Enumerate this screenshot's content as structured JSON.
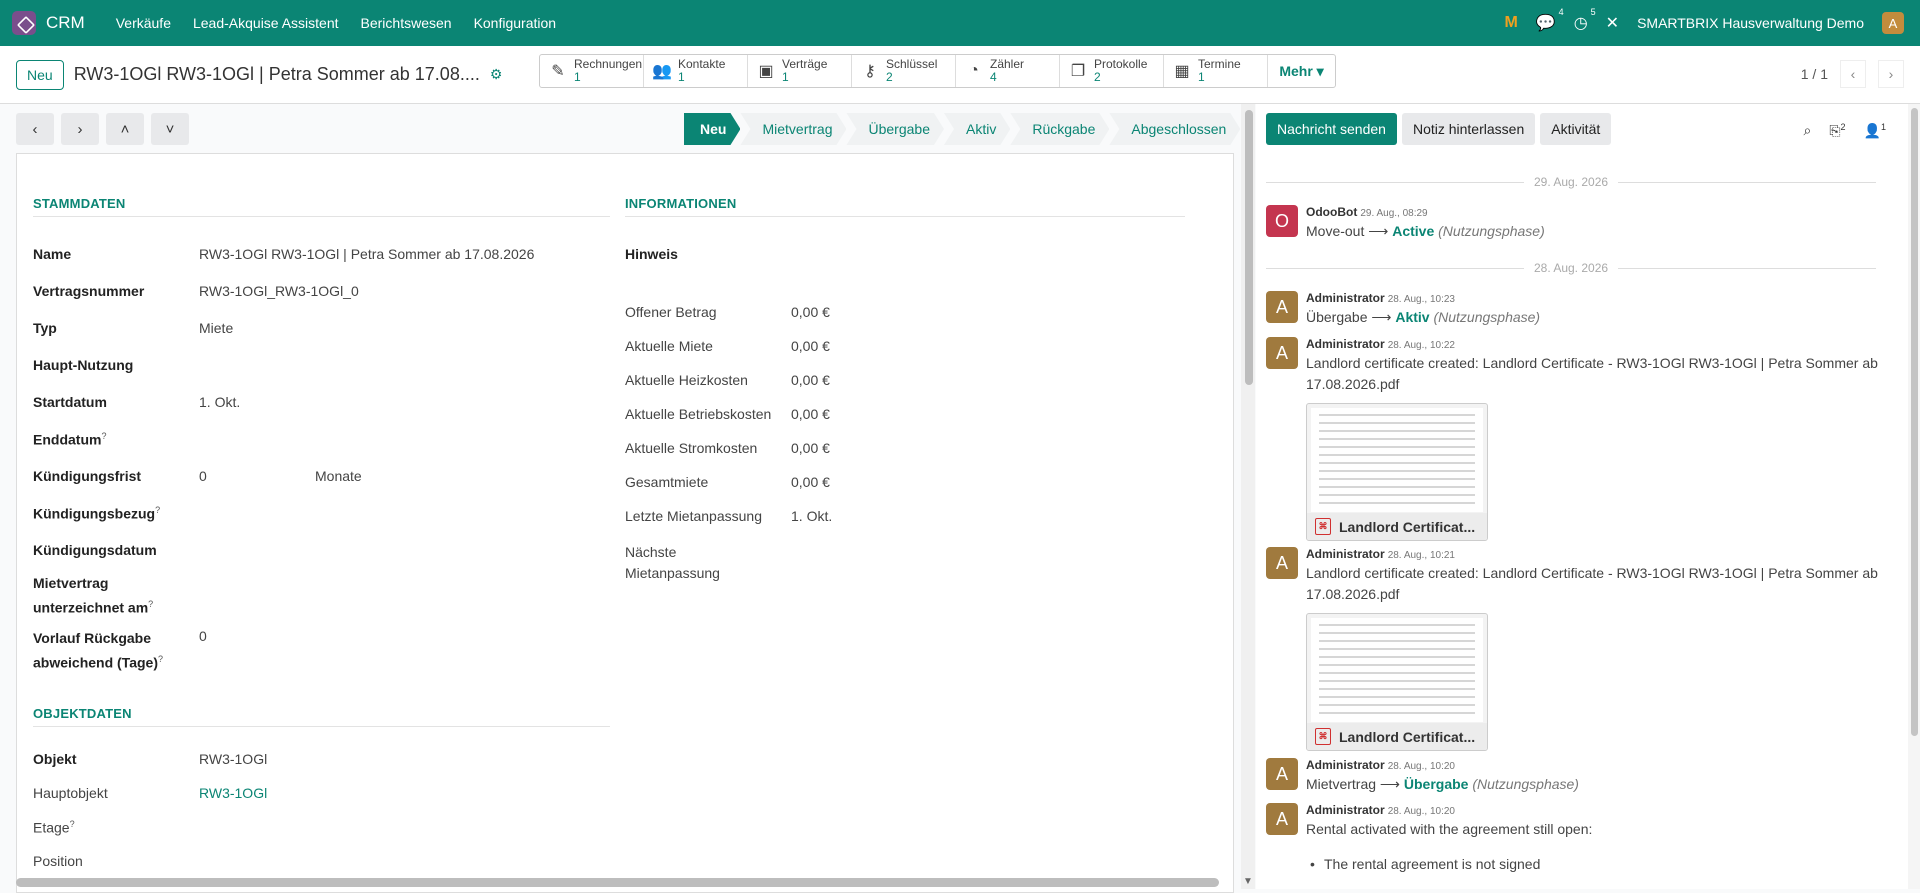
{
  "navbar": {
    "app_name": "CRM",
    "menu": [
      "Verkäufe",
      "Lead-Akquise Assistent",
      "Berichtswesen",
      "Konfiguration"
    ],
    "messages_count": "4",
    "activities_count": "5",
    "company": "SMARTBRIX Hausverwaltung Demo",
    "user_initial": "A",
    "accent": "#0b8574"
  },
  "control": {
    "new_label": "Neu",
    "record_title": "RW3-1OGl RW3-1OGl | Petra Sommer ab 17.08....",
    "smart_buttons": [
      {
        "label": "Rechnungen",
        "count": "1",
        "icon": "edit-icon"
      },
      {
        "label": "Kontakte",
        "count": "1",
        "icon": "users-icon"
      },
      {
        "label": "Verträge",
        "count": "1",
        "icon": "money-icon"
      },
      {
        "label": "Schlüssel",
        "count": "2",
        "icon": "key-icon"
      },
      {
        "label": "Zähler",
        "count": "4",
        "icon": "meter-icon"
      },
      {
        "label": "Protokolle",
        "count": "2",
        "icon": "copy-icon"
      },
      {
        "label": "Termine",
        "count": "1",
        "icon": "calendar-icon"
      }
    ],
    "more_label": "Mehr",
    "pager": "1 / 1"
  },
  "statusbar": [
    "Neu",
    "Mietvertrag",
    "Übergabe",
    "Aktiv",
    "Rückgabe",
    "Abgeschlossen"
  ],
  "stammdaten": {
    "title": "STAMMDATEN",
    "fields": [
      {
        "label": "Name",
        "value": "RW3-1OGl RW3-1OGl | Petra Sommer ab 17.08.2026"
      },
      {
        "label": "Vertragsnummer",
        "value": "RW3-1OGl_RW3-1OGl_0"
      },
      {
        "label": "Typ",
        "value": "Miete"
      },
      {
        "label": "Haupt-Nutzung",
        "value": ""
      },
      {
        "label": "Startdatum",
        "value": "1. Okt."
      },
      {
        "label": "Enddatum",
        "value": ""
      },
      {
        "label": "Kündigungsfrist",
        "value": "0",
        "unit": "Monate"
      },
      {
        "label": "Kündigungsbezug",
        "value": ""
      },
      {
        "label": "Kündigungsdatum",
        "value": ""
      },
      {
        "label": "Mietvertrag unterzeichnet am",
        "value": ""
      },
      {
        "label": "Vorlauf Rückgabe abweichend (Tage)",
        "value": "0"
      }
    ]
  },
  "informationen": {
    "title": "INFORMATIONEN",
    "hint_label": "Hinweis",
    "fields": [
      {
        "label": "Offener Betrag",
        "value": "0,00 €"
      },
      {
        "label": "Aktuelle Miete",
        "value": "0,00 €"
      },
      {
        "label": "Aktuelle Heizkosten",
        "value": "0,00 €"
      },
      {
        "label": "Aktuelle Betriebskosten",
        "value": "0,00 €"
      },
      {
        "label": "Aktuelle Stromkosten",
        "value": "0,00 €"
      },
      {
        "label": "Gesamtmiete",
        "value": "0,00 €"
      },
      {
        "label": "Letzte Mietanpassung",
        "value": "1. Okt."
      },
      {
        "label": "Nächste Mietanpassung",
        "value": ""
      }
    ]
  },
  "objektdaten": {
    "title": "OBJEKTDATEN",
    "fields": [
      {
        "label": "Objekt",
        "value": "RW3-1OGl"
      },
      {
        "label": "Hauptobjekt",
        "value": "RW3-1OGl"
      },
      {
        "label": "Etage",
        "value": ""
      },
      {
        "label": "Position",
        "value": ""
      }
    ]
  },
  "chatter": {
    "send_message": "Nachricht senden",
    "log_note": "Notiz hinterlassen",
    "activity": "Aktivität",
    "attachments_count": "2",
    "followers_count": "1",
    "dates": [
      "29. Aug. 2026",
      "28. Aug. 2026"
    ],
    "messages": [
      {
        "author": "OdooBot",
        "initial": "O",
        "time": "29. Aug., 08:29",
        "from": "Move-out",
        "to": "Active",
        "field": "(Nutzungsphase)"
      },
      {
        "author": "Administrator",
        "initial": "A",
        "time": "28. Aug., 10:23",
        "from": "Übergabe",
        "to": "Aktiv",
        "field": "(Nutzungsphase)"
      },
      {
        "author": "Administrator",
        "initial": "A",
        "time": "28. Aug., 10:22",
        "text": "Landlord certificate created: Landlord Certificate - RW3-1OGl RW3-1OGl | Petra Sommer ab 17.08.2026.pdf",
        "attachment": "Landlord Certificat..."
      },
      {
        "author": "Administrator",
        "initial": "A",
        "time": "28. Aug., 10:21",
        "text": "Landlord certificate created: Landlord Certificate - RW3-1OGl RW3-1OGl | Petra Sommer ab 17.08.2026.pdf",
        "attachment": "Landlord Certificat..."
      },
      {
        "author": "Administrator",
        "initial": "A",
        "time": "28. Aug., 10:20",
        "from": "Mietvertrag",
        "to": "Übergabe",
        "field": "(Nutzungsphase)"
      },
      {
        "author": "Administrator",
        "initial": "A",
        "time": "28. Aug., 10:20",
        "text": "Rental activated with the agreement still open:",
        "bullet": "The rental agreement is not signed"
      }
    ]
  }
}
